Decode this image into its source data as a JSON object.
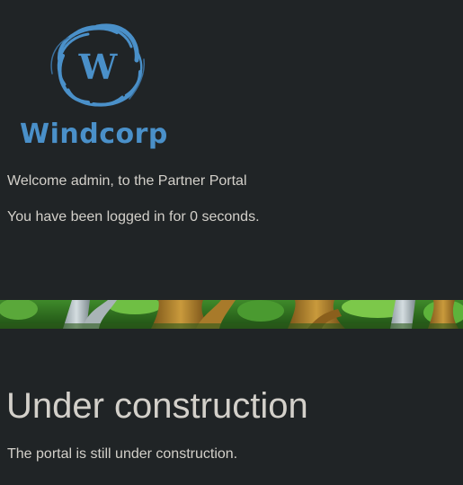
{
  "brand": {
    "name": "Windcorp",
    "logo_letter": "W",
    "logo_color": "#4a90c9",
    "logo_icon": "swirl-w-logo-icon"
  },
  "welcome": {
    "greeting": "Welcome admin, to the Partner Portal",
    "session_text": "You have been logged in for 0 seconds."
  },
  "banner": {
    "image": "forest-tree-banner"
  },
  "main": {
    "heading": "Under construction",
    "message": "The portal is still under construction."
  },
  "colors": {
    "background": "#202426",
    "text": "#d3d0ca"
  }
}
